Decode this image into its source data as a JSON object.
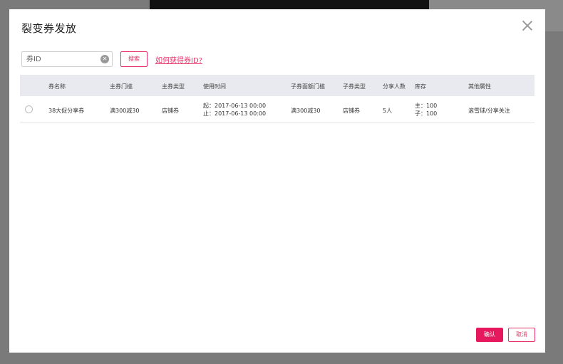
{
  "dialog": {
    "title": "裂变券发放",
    "close_icon": "close-icon"
  },
  "search": {
    "placeholder": "券ID",
    "button_label": "搜索",
    "help_link": "如何获得券ID?"
  },
  "table": {
    "headers": [
      "券名称",
      "主券门槛",
      "主券类型",
      "使用时间",
      "子券面额门槛",
      "子券类型",
      "分享人数",
      "库存",
      "其他属性"
    ],
    "rows": [
      {
        "name": "38大促分享券",
        "main_threshold": "满300减30",
        "main_type": "店铺券",
        "time_start": "起：2017-06-13 00:00",
        "time_end": "止：2017-06-13 00:00",
        "sub_threshold": "满300减30",
        "sub_type": "店铺券",
        "share_count": "5人",
        "stock_main": "主：100",
        "stock_sub": "子：100",
        "other": "滚雪球/分享关注"
      }
    ]
  },
  "footer": {
    "confirm_label": "确认",
    "cancel_label": "取消"
  },
  "colors": {
    "accent": "#e6195f",
    "header_bg": "#e8eaef",
    "overlay": "#7a7a7a"
  }
}
